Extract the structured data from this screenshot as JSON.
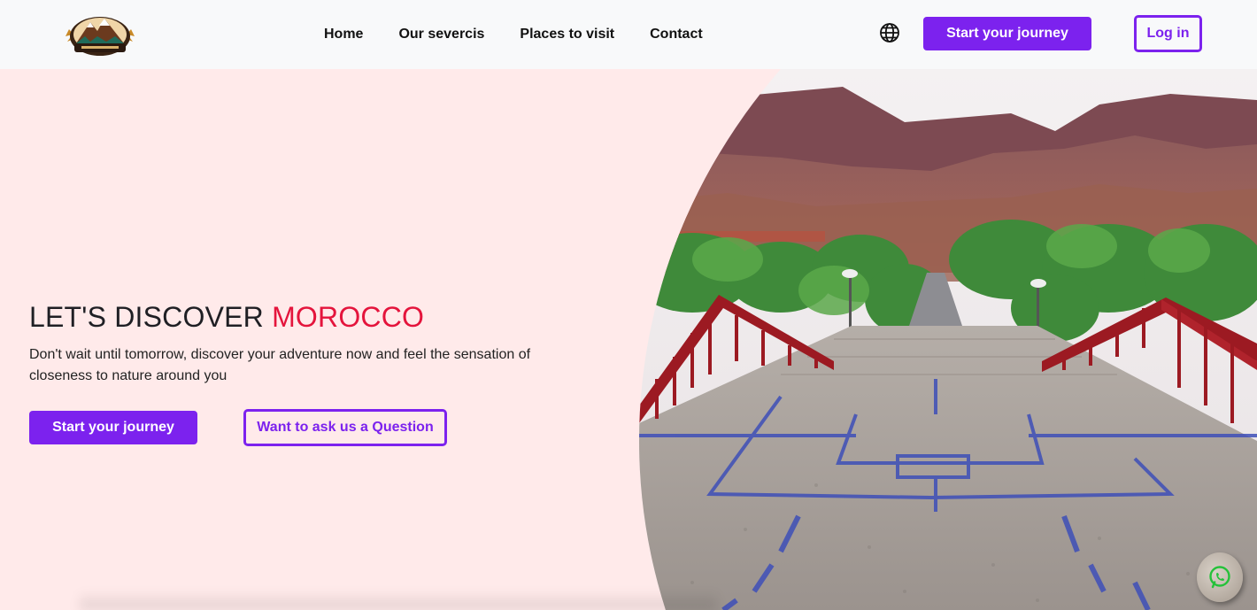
{
  "header": {
    "logo_icon": "mountain-logo-icon",
    "nav": [
      "Home",
      "Our severcis",
      "Places to visit",
      "Contact"
    ],
    "language_icon": "globe-icon",
    "start_label": "Start your journey",
    "login_label": "Log in"
  },
  "hero": {
    "title_prefix": "LET'S DISCOVER",
    "title_accent": "MOROCCO",
    "description": "Don't wait until tomorrow, discover your adventure now and feel the sensation of closeness to nature around you",
    "start_label": "Start your journey",
    "question_label": "Want to ask us a Question",
    "image": "morocco-stairs-photo"
  },
  "floating": {
    "whatsapp_icon": "whatsapp-icon"
  },
  "colors": {
    "accent": "#7c22ee",
    "highlight": "#e4143c",
    "hero_bg": "#ffeaea",
    "nav_bg": "#f8f9fa"
  }
}
